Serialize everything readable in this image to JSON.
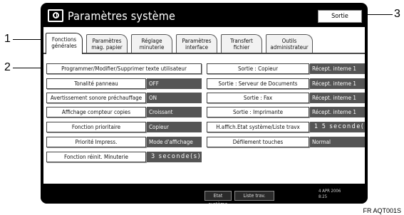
{
  "callouts": {
    "c1": "1",
    "c2": "2",
    "c3": "3"
  },
  "figure_code": "FR AQT001S",
  "window": {
    "title": "Paramètres système",
    "exit_label": "Sortie"
  },
  "tabs": [
    {
      "line1": "Fonctions",
      "line2": "générales"
    },
    {
      "line1": "Paramètres",
      "line2": "mag. papier"
    },
    {
      "line1": "Réglage",
      "line2": "minuterie"
    },
    {
      "line1": "Paramètres",
      "line2": "interface"
    },
    {
      "line1": "Transfert",
      "line2": "fichier"
    },
    {
      "line1": "Outils",
      "line2": "administrateur"
    }
  ],
  "left_settings": {
    "program_text": "Programmer/Modifier/Supprimer texte utilisateur",
    "rows": [
      {
        "label": "Tonalité panneau",
        "value": "OFF"
      },
      {
        "label": "Avertissement sonore préchauffage",
        "value": "ON"
      },
      {
        "label": "Affichage compteur copies",
        "value": "Croissant"
      },
      {
        "label": "Fonction prioritaire",
        "value": "Copieur"
      },
      {
        "label": "Priorité Impress.",
        "value": "Mode d'affichage"
      },
      {
        "label": "Fonction réinit. Minuterie",
        "value": "3 seconde(s)"
      }
    ]
  },
  "right_settings": {
    "rows": [
      {
        "label": "Sortie : Copieur",
        "value": "Récept. interne 1"
      },
      {
        "label": "Sortie : Serveur de Documents",
        "value": "Récept. interne 1"
      },
      {
        "label": "Sortie : Fax",
        "value": "Récept. interne 1"
      },
      {
        "label": "Sortie : Imprimante",
        "value": "Récept. interne 1"
      },
      {
        "label": "H.affich.Etat système/Liste travx",
        "value": "1 5 seconde(s)"
      },
      {
        "label": "Défilement touches",
        "value": "Normal"
      }
    ]
  },
  "statusbar": {
    "system_status": "Etat système",
    "job_list": "Liste trav.",
    "date": "4 APR 2006",
    "time": "8:25"
  }
}
